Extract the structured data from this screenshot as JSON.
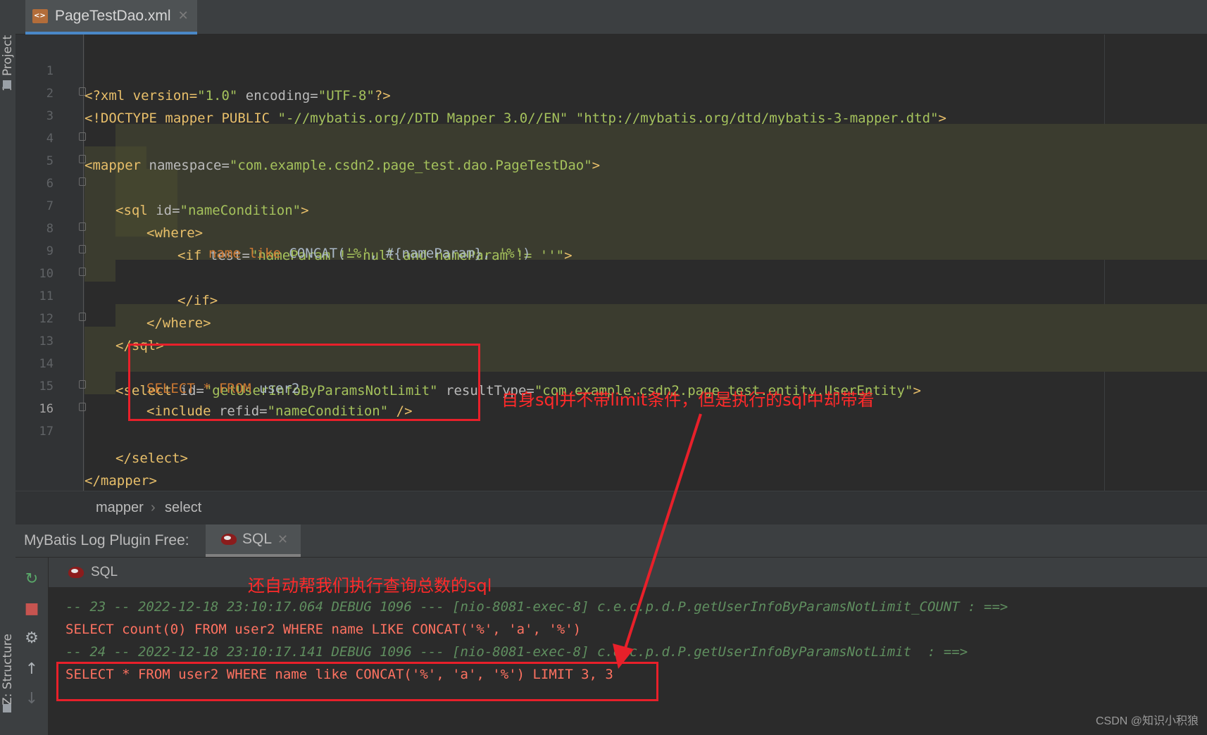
{
  "sidebar": {
    "project_label": "1: Project",
    "structure_label": "Z: Structure"
  },
  "tabs": {
    "file_tab": {
      "label": "PageTestDao.xml",
      "close": "✕"
    }
  },
  "editor": {
    "line_numbers": [
      "1",
      "2",
      "3",
      "4",
      "5",
      "6",
      "7",
      "8",
      "9",
      "10",
      "11",
      "12",
      "13",
      "14",
      "15",
      "16",
      "17"
    ],
    "lines": {
      "l1": {
        "a": "<?xml version=",
        "b": "\"1.0\"",
        "c": " encoding=",
        "d": "\"UTF-8\"",
        "e": "?>"
      },
      "l2": {
        "a": "<!DOCTYPE mapper PUBLIC ",
        "b": "\"-//mybatis.org//DTD Mapper 3.0//EN\" \"http://mybatis.org/dtd/mybatis-3-mapper.dtd\"",
        "c": ">"
      },
      "l3": {
        "a": "<mapper ",
        "b": "namespace=",
        "c": "\"com.example.csdn2.page_test.dao.PageTestDao\"",
        "d": ">"
      },
      "l5": {
        "a": "<sql ",
        "b": "id=",
        "c": "\"nameCondition\"",
        "d": ">"
      },
      "l6": {
        "a": "<where>"
      },
      "l7": {
        "a": "<if ",
        "b": "test=",
        "c": "\"nameParam != null and nameParam != ''\"",
        "d": ">"
      },
      "l8": {
        "a": "name like ",
        "b": "CONCAT(",
        "c": "'%'",
        "d": ", #{nameParam}, ",
        "e": "'%'",
        "f": ")"
      },
      "l9": {
        "a": "</if>"
      },
      "l10": {
        "a": "</where>"
      },
      "l11": {
        "a": "</sql>"
      },
      "l13": {
        "a": "<select ",
        "b": "id=",
        "c": "\"getUserInfoByParamsNotLimit\"",
        "d": " resultType=",
        "e": "\"com.example.csdn2.page_test.entity.UserEntity\"",
        "f": ">"
      },
      "l14": {
        "a": "SELECT * FROM ",
        "b": "user2"
      },
      "l15": {
        "a": "<include ",
        "b": "refid=",
        "c": "\"nameCondition\"",
        "d": " />"
      },
      "l16": {
        "a": "</select>"
      },
      "l17": {
        "a": "</mapper>"
      }
    }
  },
  "breadcrumb": {
    "items": [
      "mapper",
      "select"
    ],
    "separator": "›"
  },
  "tool_window": {
    "title": "MyBatis Log Plugin Free:",
    "tab_label": "SQL",
    "tab_close": "✕",
    "console_title": "SQL",
    "buttons": {
      "rerun": "↻",
      "stop": "■",
      "settings": "⚙",
      "up": "↑",
      "down": "↓"
    },
    "log": [
      {
        "kind": "debug",
        "text": "-- 23 -- 2022-12-18 23:10:17.064 DEBUG 1096 --- [nio-8081-exec-8] c.e.c.p.d.P.getUserInfoByParamsNotLimit_COUNT : ==>"
      },
      {
        "kind": "sql",
        "text": "SELECT count(0) FROM user2 WHERE name LIKE CONCAT('%', 'a', '%')"
      },
      {
        "kind": "debug",
        "text": "-- 24 -- 2022-12-18 23:10:17.141 DEBUG 1096 --- [nio-8081-exec-8] c.e.c.p.d.P.getUserInfoByParamsNotLimit  : ==>"
      },
      {
        "kind": "sql",
        "text": "SELECT * FROM user2 WHERE name like CONCAT('%', 'a', '%') LIMIT 3, 3"
      }
    ]
  },
  "annotations": {
    "note_editor": "自身sql并不带limit条件，但是执行的sql中却带着",
    "note_console": "还自动帮我们执行查询总数的sql",
    "color": "#e8202a"
  },
  "watermark": "CSDN @知识小积狼"
}
